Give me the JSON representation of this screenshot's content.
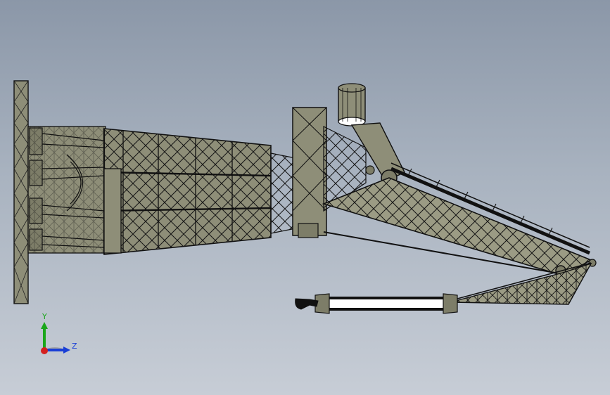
{
  "viewport": {
    "background_top": "#8b97a8",
    "background_bottom": "#c7cdd6",
    "model_fill": "#8e8e78",
    "edge_color": "#111111"
  },
  "triad": {
    "y_label": "Y",
    "z_label": "Z",
    "y_color": "#1aa61a",
    "z_color": "#1a3fd6",
    "x_color": "#d42020"
  }
}
